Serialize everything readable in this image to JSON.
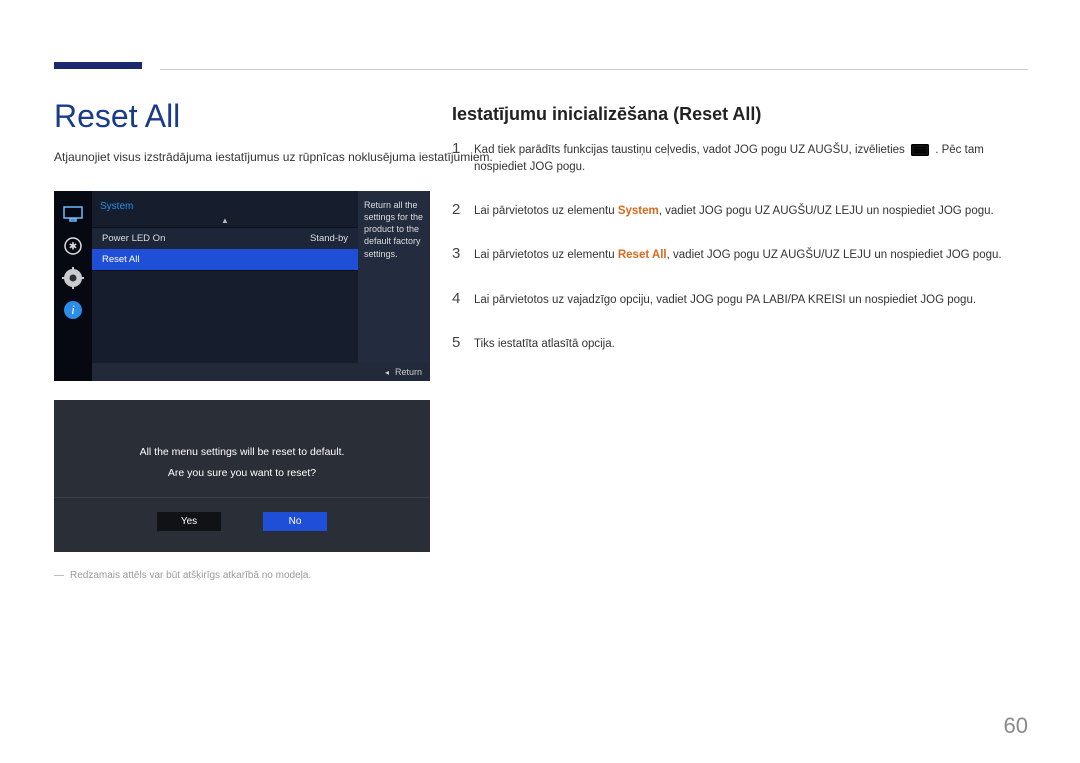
{
  "page_title": "Reset All",
  "intro_text": "Atjaunojiet visus izstrādājuma iestatījumus uz rūpnīcas noklusējuma iestatījumiem.",
  "right_heading": "Iestatījumu inicializēšana (Reset All)",
  "steps": [
    {
      "num": "1",
      "pre": "Kad tiek parādīts funkcijas taustiņu ceļvedis, vadot JOG pogu UZ AUGŠU, izvēlieties",
      "post": ". Pēc tam nospiediet JOG pogu."
    },
    {
      "num": "2",
      "pre": "Lai pārvietotos uz elementu ",
      "hl": "System",
      "post": ", vadiet JOG pogu UZ AUGŠU/UZ LEJU un nospiediet JOG pogu."
    },
    {
      "num": "3",
      "pre": "Lai pārvietotos uz elementu ",
      "hl_bold": "Reset All",
      "post": ", vadiet JOG pogu UZ AUGŠU/UZ LEJU un nospiediet JOG pogu."
    },
    {
      "num": "4",
      "text": "Lai pārvietotos uz vajadzīgo opciju, vadiet JOG pogu PA LABI/PA KREISI un nospiediet JOG pogu."
    },
    {
      "num": "5",
      "text": "Tiks iestatīta atlasītā opcija."
    }
  ],
  "osd1": {
    "title": "System",
    "rows": [
      {
        "label": "Power LED On",
        "value": "Stand-by"
      },
      {
        "label": "Reset All",
        "value": ""
      }
    ],
    "desc": "Return all the settings for the product to the default factory settings.",
    "return": "Return"
  },
  "osd2": {
    "line1": "All the menu settings will be reset to default.",
    "line2": "Are you sure you want to reset?",
    "yes": "Yes",
    "no": "No"
  },
  "footnote_dash": "―",
  "footnote": "Redzamais attēls var būt atšķirīgs atkarībā no modeļa.",
  "page_number": "60"
}
